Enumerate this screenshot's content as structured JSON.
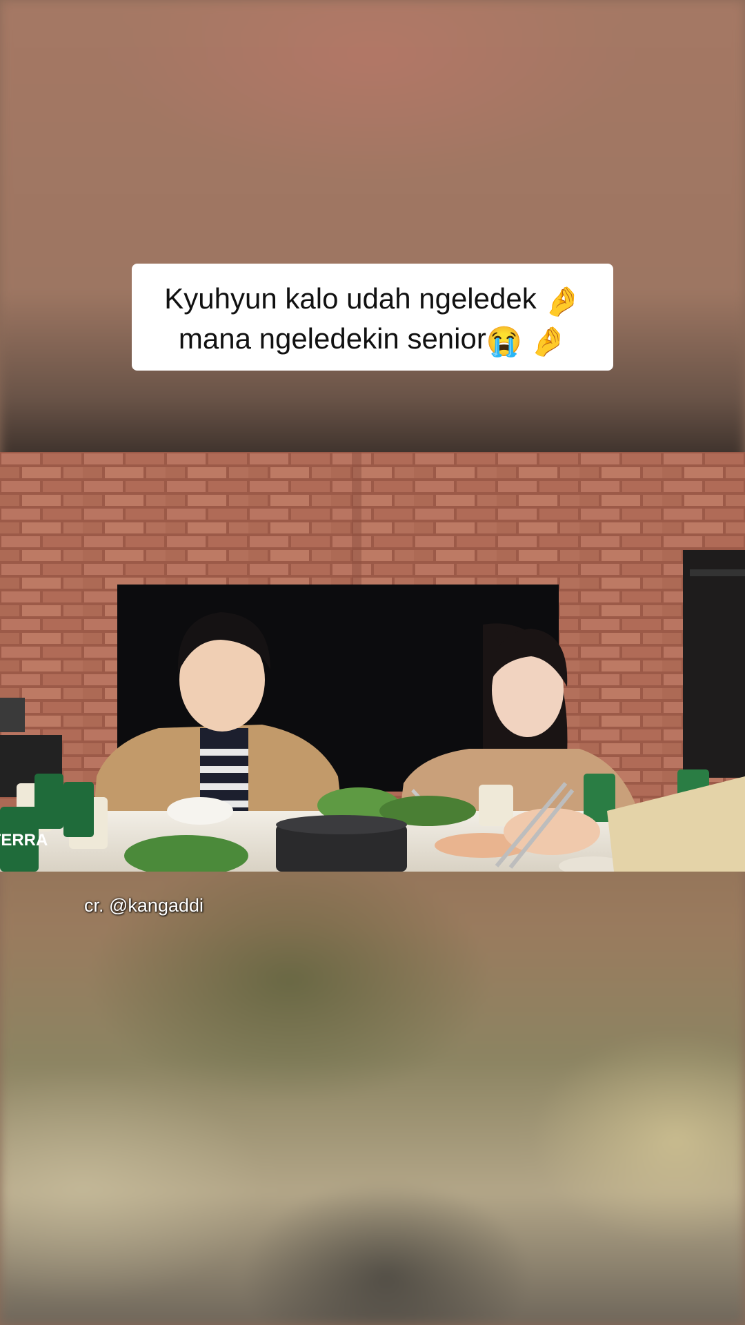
{
  "caption": {
    "line1": "Kyuhyun kalo udah ngeledek",
    "line1_emoji": "🤌",
    "line2": "mana ngeledekin senior",
    "line2_emoji_1": "😭",
    "line2_emoji_2": "🤌"
  },
  "credit": "cr. @kangaddi",
  "video": {
    "can_brand": "TERRA"
  },
  "colors": {
    "caption_bg": "#ffffff",
    "caption_text": "#111111",
    "brick": "#b5715c",
    "cardigan": "#c29a6a"
  }
}
